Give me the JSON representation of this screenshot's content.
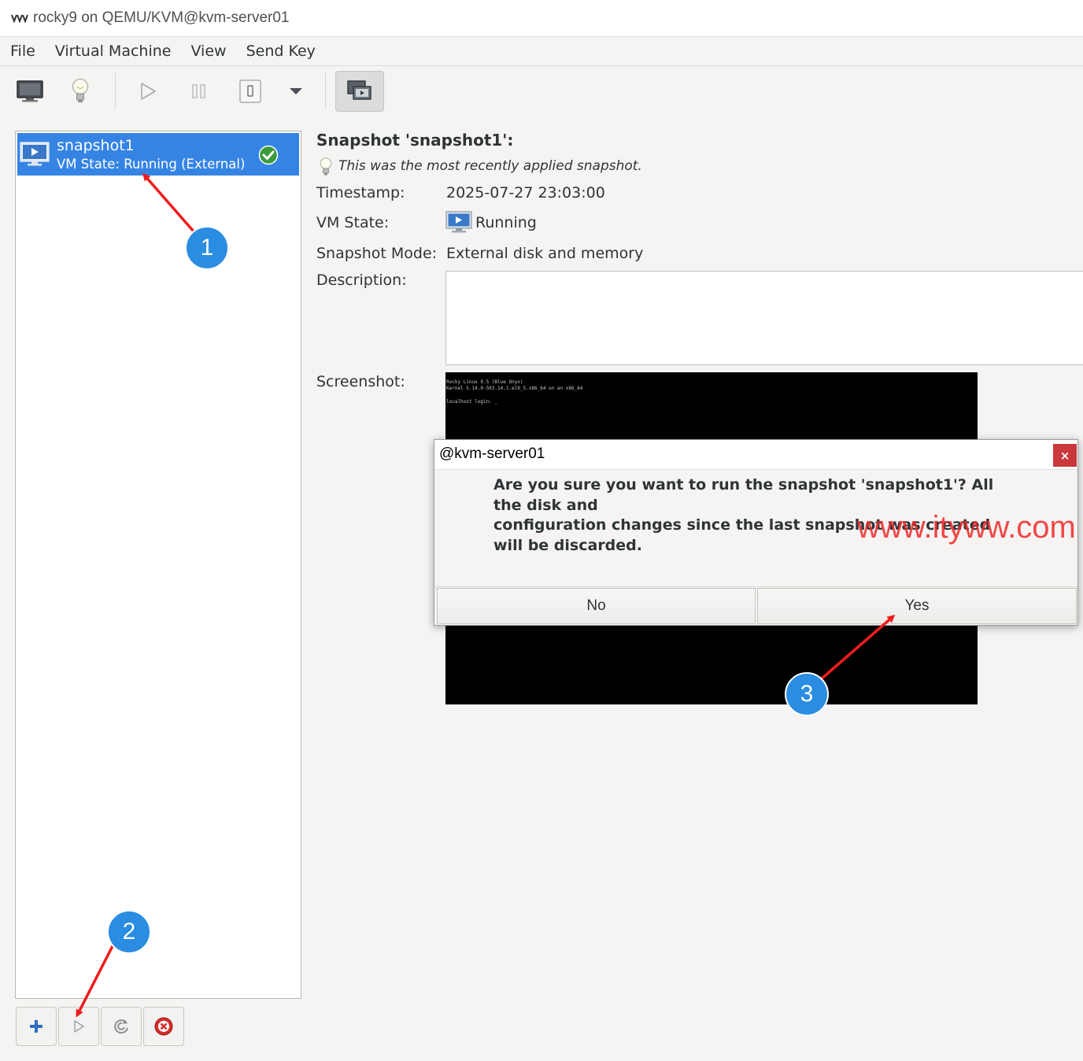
{
  "window": {
    "title": "rocky9 on QEMU/KVM@kvm-server01"
  },
  "menu": [
    {
      "label": "File"
    },
    {
      "label": "Virtual Machine"
    },
    {
      "label": "View"
    },
    {
      "label": "Send Key"
    }
  ],
  "toolbar": {
    "icons": [
      "monitor-icon",
      "lightbulb-icon",
      "play-icon",
      "pause-icon",
      "power-icon",
      "dropdown-arrow-icon",
      "snapshots-icon"
    ]
  },
  "snapshot_list": {
    "items": [
      {
        "name": "snapshot1",
        "state": "VM State: Running (External)",
        "current": true
      }
    ],
    "selected_color": "#3584e4"
  },
  "details": {
    "title": "Snapshot 'snapshot1':",
    "recent_note": "This was the most recently applied snapshot.",
    "timestamp_label": "Timestamp:",
    "timestamp_value": "2025-07-27 23:03:00",
    "vm_state_label": "VM State:",
    "vm_state_value": "Running",
    "mode_label": "Snapshot Mode:",
    "mode_value": "External disk and memory",
    "description_label": "Description:",
    "description_value": "",
    "screenshot_label": "Screenshot:",
    "screenshot_lines": [
      "Rocky Linux 9.5 (Blue Onyx)",
      "Kernel 5.14.0-503.14.1.el9_5.x86_64 on an x86_64",
      "localhost login: _"
    ]
  },
  "dialog": {
    "title": "@kvm-server01",
    "close_label": "×",
    "message_lines": [
      "Are you sure you want to run the snapshot 'snapshot1'? All",
      "the disk and",
      "configuration changes since the last snapshot was created",
      "will be discarded."
    ],
    "no_label": "No",
    "yes_label": "Yes",
    "close_color": "#c9383c"
  },
  "watermark": "www.ityww.com",
  "annotations": [
    {
      "number": "1"
    },
    {
      "number": "2"
    },
    {
      "number": "3"
    }
  ],
  "list_buttons": [
    "add-icon",
    "run-snapshot-icon",
    "refresh-icon",
    "delete-icon"
  ]
}
